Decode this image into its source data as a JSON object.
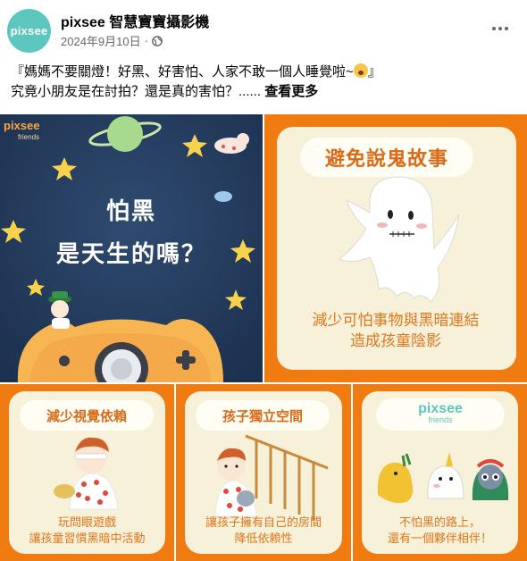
{
  "header": {
    "avatar_text": "pixsee",
    "page_name": "pixsee 智慧寶寶攝影機",
    "date": "2024年9月10日",
    "separator": "·",
    "privacy_icon": "globe-icon",
    "more_icon": "more-options-icon"
  },
  "post": {
    "line1": "『媽媽不要關燈！好黑、好害怕、人家不敢一個人睡覺啦~",
    "line1_end": "』",
    "line2": "究竟小朋友是在討拍？還是真的害怕？......",
    "see_more": "查看更多"
  },
  "images": {
    "img1": {
      "brand": "pixsee",
      "brand_sub": "friends",
      "title_line1": "怕黑",
      "title_line2": "是天生的嗎？"
    },
    "img2": {
      "heading": "避免說鬼故事",
      "caption_line1": "減少可怕事物與黑暗連結",
      "caption_line2": "造成孩童陰影"
    },
    "img3": {
      "heading": "減少視覺依賴",
      "caption_line1": "玩問眼遊戲",
      "caption_line2": "讓孩童習慣黑暗中活動"
    },
    "img4": {
      "heading": "孩子獨立空間",
      "caption_line1": "讓孩子擁有自己的房間",
      "caption_line2": "降低依賴性"
    },
    "img5": {
      "brand": "pixsee",
      "brand_sub": "friends",
      "caption_line1": "不怕黑的路上，",
      "caption_line2": "還有一個夥伴相伴！"
    }
  },
  "colors": {
    "accent_orange": "#f07b11",
    "night_blue": "#243b5c",
    "card_cream": "#f6f1d8",
    "avatar_teal": "#5cc6bf"
  }
}
